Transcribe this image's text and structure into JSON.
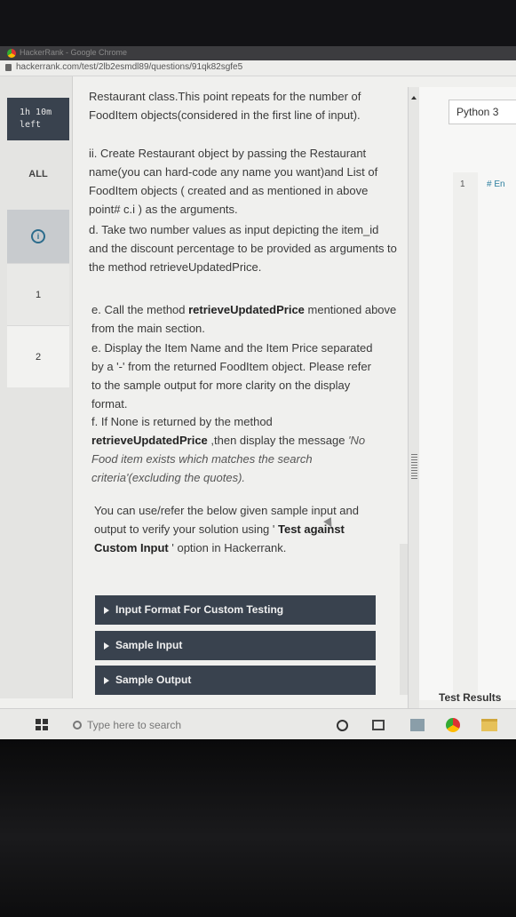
{
  "browser": {
    "title": "HackerRank - Google Chrome",
    "url": "hackerrank.com/test/2lb2esmdl89/questions/91qk82sgfe5"
  },
  "rail": {
    "timer_line1": "1h 10m",
    "timer_line2": "left",
    "all_label": "ALL",
    "info_label": "i",
    "q1_label": "1",
    "q2_label": "2"
  },
  "problem": {
    "p1": "Restaurant class.This point repeats for the number of FoodItem objects(considered in the first line of input).",
    "p2": "ii. Create Restaurant object by passing the Restaurant name(you can hard-code any name you want)and List of FoodItem objects ( created and as mentioned in above point# c.i ) as the arguments.",
    "p3": "d. Take two number values as input depicting the item_id and the discount percentage to be provided as arguments to the method retrieveUpdatedPrice.",
    "p4_prefix": "e. Call the method ",
    "p4_bold": "retrieveUpdatedPrice",
    "p4_suffix": " mentioned above from the main section.",
    "p5": "e. Display the Item Name and the Item Price separated by a '-' from the returned FoodItem object. Please refer to the sample output for more clarity on the display format.",
    "p6_prefix": "f. If None is returned by the method ",
    "p6_bold": "retrieveUpdatedPrice",
    "p6_suffix": " ,then display the message ",
    "p6_italic": "'No Food item exists which matches the search criteria'(excluding the quotes).",
    "p7_prefix": "You can use/refer the below given sample input and output to verify your solution using ' ",
    "p7_bold1": "Test against Custom Input",
    "p7_suffix": " ' option in Hackerrank.",
    "btn_custom": "Input Format For Custom Testing",
    "btn_sample_in": "Sample Input",
    "btn_sample_out": "Sample Output"
  },
  "editor": {
    "language": "Python 3",
    "line_no": "1",
    "code": "# En",
    "test_results": "Test Results"
  },
  "taskbar": {
    "search_placeholder": "Type here to search"
  },
  "colors": {
    "accent_dark": "#39424e",
    "link_blue": "#2d7f9f"
  }
}
